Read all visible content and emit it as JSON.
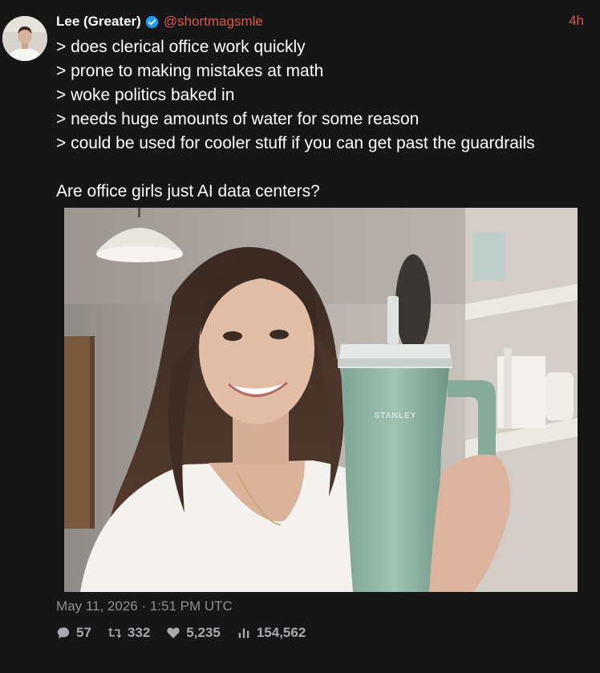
{
  "author": {
    "name": "Lee (Greater)",
    "handle": "@shortmagsmle",
    "verified_icon": "verified-badge-icon",
    "time_ago": "4h"
  },
  "tweet": {
    "lines": [
      "> does clerical office work quickly",
      "> prone to making mistakes at math",
      "> woke politics baked in",
      "> needs huge amounts of water for some reason",
      "> could be used for cooler stuff if you can get past the guardrails"
    ],
    "question": "Are office girls just AI data centers?"
  },
  "media": {
    "cup_brand": "STANLEY"
  },
  "timestamp": "May 11, 2026 · 1:51 PM UTC",
  "stats": {
    "replies": "57",
    "retweets": "332",
    "likes": "5,235",
    "views": "154,562"
  },
  "colors": {
    "background": "#161616",
    "accent": "#e0564f",
    "verified": "#1d9bf0",
    "muted": "#8d8f93"
  }
}
